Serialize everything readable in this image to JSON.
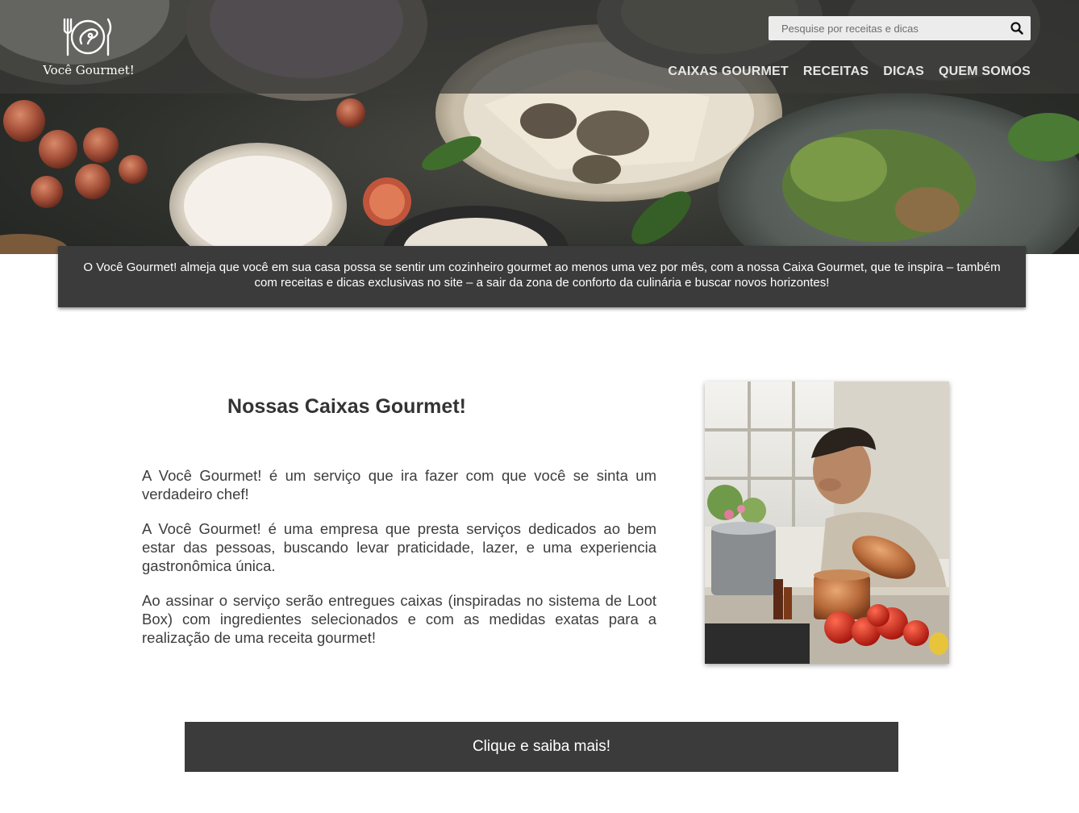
{
  "brand": {
    "name": "Você Gourmet!",
    "logo_icon": "plate-fork-knife-icon"
  },
  "search": {
    "placeholder": "Pesquise por receitas e dicas",
    "icon": "search-icon"
  },
  "nav": [
    {
      "label": "CAIXAS GOURMET"
    },
    {
      "label": "RECEITAS"
    },
    {
      "label": "DICAS"
    },
    {
      "label": "QUEM SOMOS"
    }
  ],
  "intro": {
    "text": "O Você Gourmet! almeja que você em sua casa possa se sentir um cozinheiro gourmet ao menos uma vez por mês, com a nossa Caixa Gourmet, que te inspira – também com receitas e dicas exclusivas no site – a sair da zona de conforto da culinária e buscar novos horizontes!"
  },
  "main": {
    "title": "Nossas Caixas Gourmet!",
    "paragraphs": [
      "A Você Gourmet! é um serviço que ira fazer com que você se sinta um verdadeiro chef!",
      "A Você Gourmet! é uma empresa que presta serviços dedicados ao bem estar das pessoas, buscando levar praticidade, lazer, e uma experiencia gastronômica única.",
      "Ao assinar o serviço serão entregues caixas (inspiradas no sistema de Loot Box) com ingredientes selecionados e com as medidas exatas para a realização de uma receita gourmet!"
    ]
  },
  "cta": {
    "label": "Clique e saiba mais!"
  },
  "colors": {
    "dark_panel": "#3b3b3b",
    "topbar_overlay": "#3a3a38",
    "nav_text": "#e6e6e6"
  }
}
